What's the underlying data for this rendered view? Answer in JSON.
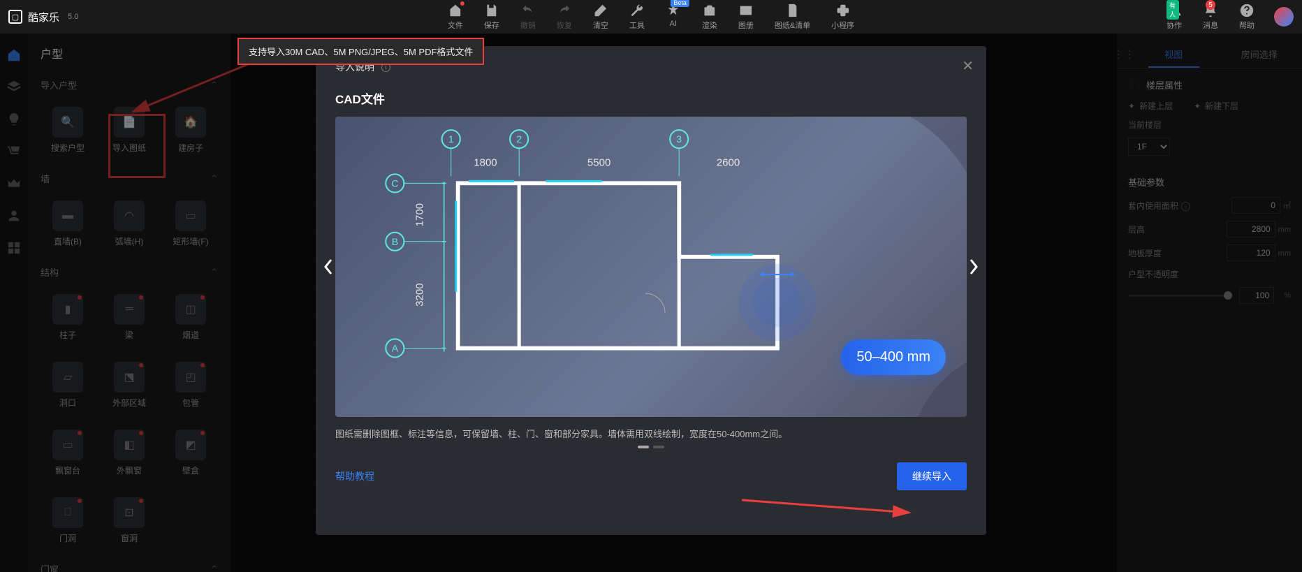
{
  "app": {
    "name": "酷家乐",
    "version": "5.0"
  },
  "toolbar": {
    "center": [
      {
        "icon": "home",
        "label": "文件",
        "badge": "red"
      },
      {
        "icon": "save",
        "label": "保存"
      },
      {
        "icon": "undo",
        "label": "撤销",
        "dim": true
      },
      {
        "icon": "redo",
        "label": "恢复",
        "dim": true
      },
      {
        "icon": "eraser",
        "label": "清空"
      },
      {
        "icon": "wrench",
        "label": "工具"
      },
      {
        "icon": "ai",
        "label": "AI",
        "badge": "beta"
      },
      {
        "icon": "camera",
        "label": "渲染"
      },
      {
        "icon": "image",
        "label": "图册"
      },
      {
        "icon": "doc",
        "label": "图纸&清单"
      },
      {
        "icon": "puzzle",
        "label": "小程序"
      }
    ],
    "right": [
      {
        "icon": "people",
        "label": "协作",
        "badge": "green_text",
        "badge_text": "有人"
      },
      {
        "icon": "bell",
        "label": "消息",
        "badge": "red_num",
        "badge_text": "5"
      },
      {
        "icon": "help",
        "label": "帮助"
      }
    ]
  },
  "sidebar": {
    "title": "户型",
    "sections": [
      {
        "name": "导入户型",
        "items": [
          {
            "icon": "search",
            "label": "搜索户型"
          },
          {
            "icon": "import",
            "label": "导入图纸",
            "highlight": true
          },
          {
            "icon": "build",
            "label": "建房子"
          }
        ]
      },
      {
        "name": "墙",
        "items": [
          {
            "icon": "wall",
            "label": "直墙(B)"
          },
          {
            "icon": "arc",
            "label": "弧墙(H)"
          },
          {
            "icon": "rect",
            "label": "矩形墙(F)"
          }
        ]
      },
      {
        "name": "结构",
        "items": [
          {
            "icon": "col",
            "label": "柱子",
            "dot": true
          },
          {
            "icon": "beam",
            "label": "梁",
            "dot": true
          },
          {
            "icon": "flue",
            "label": "烟道",
            "dot": true
          },
          {
            "icon": "open",
            "label": "洞口"
          },
          {
            "icon": "ext",
            "label": "外部区域",
            "dot": true
          },
          {
            "icon": "pipe",
            "label": "包管",
            "dot": true
          },
          {
            "icon": "bay",
            "label": "飘窗台",
            "dot": true
          },
          {
            "icon": "obay",
            "label": "外飘窗",
            "dot": true
          },
          {
            "icon": "niche",
            "label": "壁盒",
            "dot": true
          },
          {
            "icon": "dop",
            "label": "门洞",
            "dot": true
          },
          {
            "icon": "wop",
            "label": "窗洞",
            "dot": true
          }
        ]
      },
      {
        "name": "门窗"
      }
    ]
  },
  "tooltip": "支持导入30M CAD、5M PNG/JPEG、5M PDF格式文件",
  "modal": {
    "title": "导入说明",
    "subtitle": "CAD文件",
    "desc": "图纸需删除图框、标注等信息，可保留墙、柱、门、窗和部分家具。墙体需用双线绘制，宽度在50-400mm之间。",
    "help_link": "帮助教程",
    "continue": "继续导入",
    "badge": "50–400 mm",
    "numbers": [
      "1",
      "2",
      "3"
    ],
    "letters": [
      "C",
      "B",
      "A"
    ],
    "top_dims": [
      "1800",
      "5500",
      "2600"
    ],
    "left_dims": [
      "1700",
      "3200"
    ]
  },
  "right_panel": {
    "tabs": [
      "视图",
      "房间选择"
    ],
    "floor_props_title": "楼层属性",
    "new_up": "新建上层",
    "new_down": "新建下层",
    "current_floor_label": "当前楼层",
    "current_floor_value": "1F",
    "basic_title": "基础参数",
    "indoor_area_label": "套内使用面积",
    "indoor_area_value": "0",
    "floor_height_label": "层高",
    "floor_height_value": "2800",
    "slab_label": "地板厚度",
    "slab_value": "120",
    "opacity_label": "户型不透明度",
    "opacity_value": "100",
    "unit_mm": "mm",
    "unit_m2": "㎡",
    "unit_pct": "%"
  }
}
